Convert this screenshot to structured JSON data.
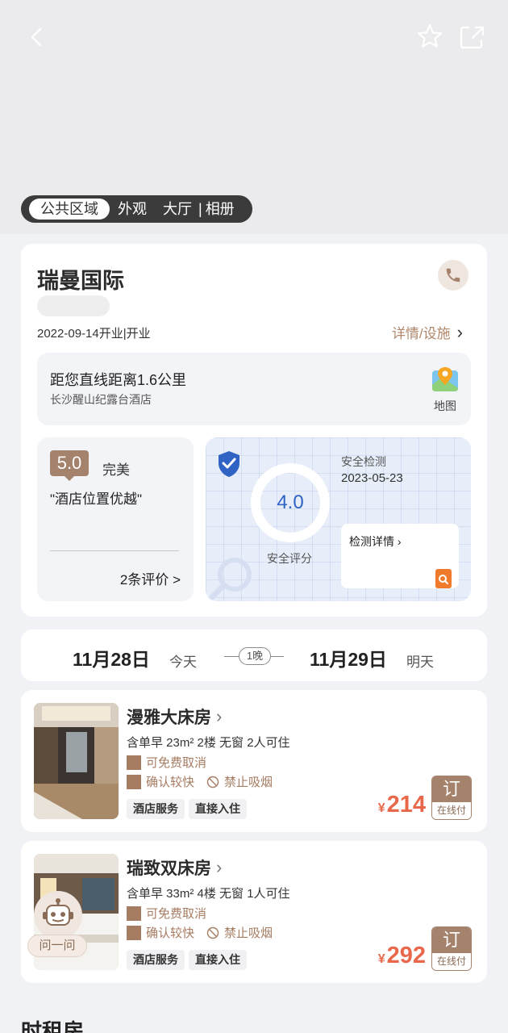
{
  "nav": {
    "back_icon": "back-arrow-icon",
    "favorite_icon": "star-icon",
    "share_icon": "share-icon"
  },
  "photo_tabs": [
    {
      "label": "公共区域",
      "active": true
    },
    {
      "label": "外观",
      "active": false
    },
    {
      "label": "大厅",
      "active": false
    },
    {
      "label": "|",
      "active": false
    },
    {
      "label": "相册",
      "active": false
    }
  ],
  "hotel": {
    "name": "瑞曼国际",
    "open_date": "2022-09-14开业|开业",
    "detail_link": "详情/设施",
    "distance_text": "距您直线距离1.6公里",
    "address": "长沙醒山纪露台酒店",
    "map_label": "地图"
  },
  "rating": {
    "score": "5.0",
    "word": "完美",
    "quote": "\"酒店位置优越\"",
    "reviews_link": "2条评价 >"
  },
  "safety": {
    "score": "4.0",
    "score_label": "安全评分",
    "title": "安全检测",
    "date": "2023-05-23",
    "detail_link": "检测详情"
  },
  "dates": {
    "checkin": "11月28日",
    "checkin_sub": "今天",
    "nights": "1晚",
    "checkout": "11月29日",
    "checkout_sub": "明天"
  },
  "rooms": [
    {
      "name": "漫雅大床房",
      "desc": "含单早 23m² 2楼 无窗 2人可住",
      "perk1": "可免费取消",
      "perk2": "确认较快",
      "smoke": "禁止吸烟",
      "tags": [
        "酒店服务",
        "直接入住"
      ],
      "currency": "¥",
      "price": "214",
      "book_label": "订",
      "book_sub": "在线付"
    },
    {
      "name": "瑞致双床房",
      "desc": "含单早 33m² 4楼 无窗 1人可住",
      "perk1": "可免费取消",
      "perk2": "确认较快",
      "smoke": "禁止吸烟",
      "tags": [
        "酒店服务",
        "直接入住"
      ],
      "currency": "¥",
      "price": "292",
      "book_label": "订",
      "book_sub": "在线付"
    }
  ],
  "assistant": {
    "label": "问一问"
  },
  "next_section": "时租房",
  "colors": {
    "accent": "#a4826b",
    "price": "#e9684b",
    "safety_blue": "#2f63c4"
  }
}
